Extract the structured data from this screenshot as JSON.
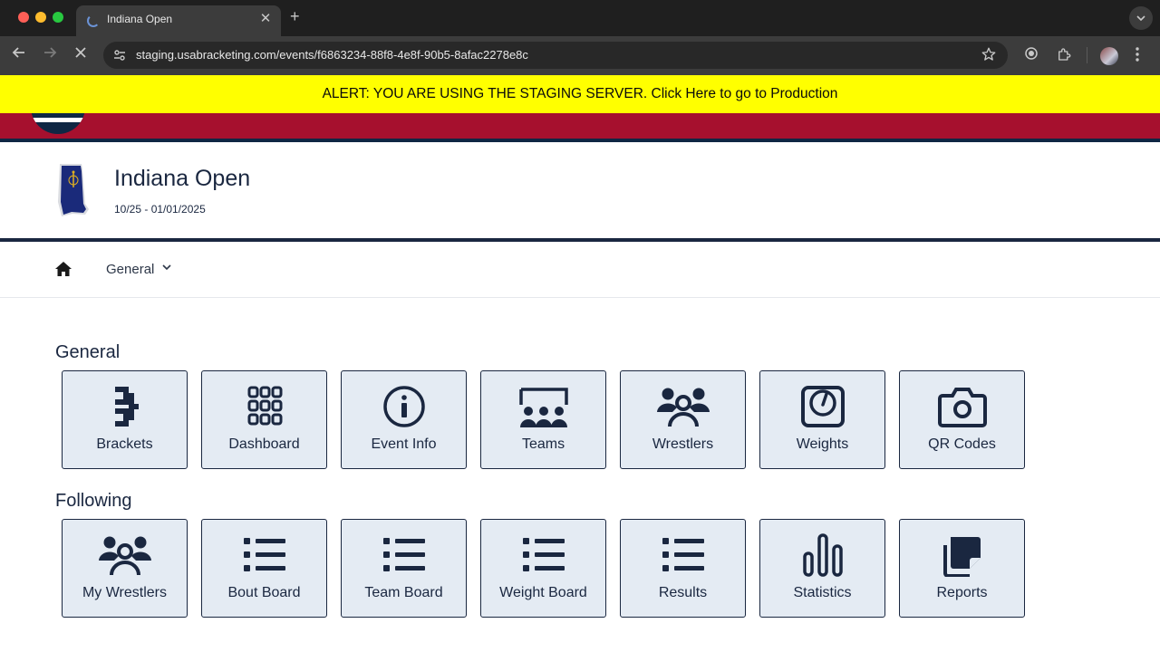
{
  "browser": {
    "tab_title": "Indiana Open",
    "tab_close": "✕",
    "new_tab": "+",
    "url": "staging.usabracketing.com/events/f6863234-88f8-4e8f-90b5-8afac2278e8c"
  },
  "alert": {
    "text": "ALERT: YOU ARE USING THE STAGING SERVER. Click Here to go to Production",
    "color": "#ffff00"
  },
  "brand": {
    "primary": "#a6102e",
    "navy": "#0f2744"
  },
  "event": {
    "title": "Indiana Open",
    "dates": "10/25 - 01/01/2025"
  },
  "subnav": {
    "menu_label": "General",
    "chevron": "⌄"
  },
  "sections": {
    "general": {
      "title": "General",
      "tiles": [
        {
          "label": "Brackets",
          "icon": "brackets-icon"
        },
        {
          "label": "Dashboard",
          "icon": "grid-icon"
        },
        {
          "label": "Event Info",
          "icon": "info-icon"
        },
        {
          "label": "Teams",
          "icon": "teams-icon"
        },
        {
          "label": "Wrestlers",
          "icon": "users-icon"
        },
        {
          "label": "Weights",
          "icon": "scale-icon"
        },
        {
          "label": "QR Codes",
          "icon": "camera-icon"
        }
      ]
    },
    "following": {
      "title": "Following",
      "tiles": [
        {
          "label": "My Wrestlers",
          "icon": "users-icon"
        },
        {
          "label": "Bout Board",
          "icon": "list-icon"
        },
        {
          "label": "Team Board",
          "icon": "list-icon"
        },
        {
          "label": "Weight Board",
          "icon": "list-icon"
        },
        {
          "label": "Results",
          "icon": "list-icon"
        },
        {
          "label": "Statistics",
          "icon": "bar-chart-icon"
        },
        {
          "label": "Reports",
          "icon": "copy-icon"
        }
      ]
    }
  }
}
